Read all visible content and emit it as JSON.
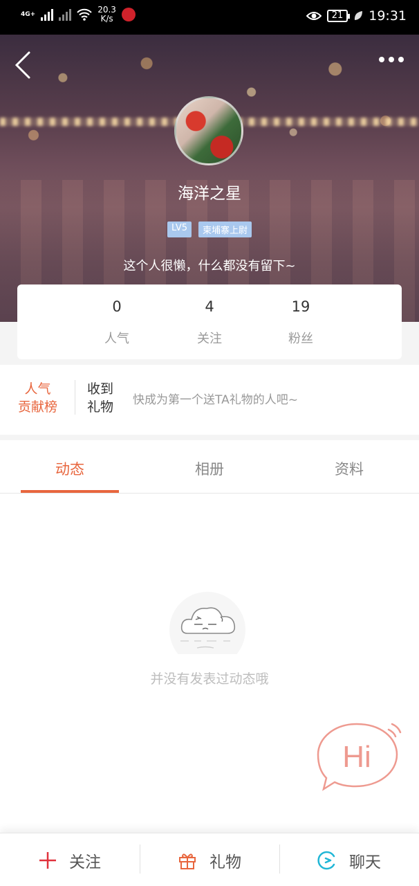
{
  "status_bar": {
    "network_type": "4G+",
    "speed_value": "20.3",
    "speed_unit": "K/s",
    "battery_level": "21",
    "time": "19:31",
    "icons": [
      "signal-icon",
      "wifi-icon",
      "weibo-icon",
      "eye-icon",
      "battery-icon",
      "leaf-icon"
    ]
  },
  "profile": {
    "nickname": "海洋之星",
    "level_badge": "LV5",
    "title_badge": "柬埔寨上尉",
    "bio": "这个人很懒，什么都没有留下~"
  },
  "stats": [
    {
      "value": "0",
      "label": "人气"
    },
    {
      "value": "4",
      "label": "关注"
    },
    {
      "value": "19",
      "label": "粉丝"
    }
  ],
  "gifts": {
    "rank_line1": "人气",
    "rank_line2": "贡献榜",
    "received_line1": "收到",
    "received_line2": "礼物",
    "prompt": "快成为第一个送TA礼物的人吧~"
  },
  "tabs": [
    {
      "label": "动态",
      "active": true
    },
    {
      "label": "相册",
      "active": false
    },
    {
      "label": "资料",
      "active": false
    }
  ],
  "empty_state": {
    "message": "并没有发表过动态哦"
  },
  "hi_button": {
    "label": "Hi"
  },
  "bottom_bar": {
    "follow": "关注",
    "gift": "礼物",
    "chat": "聊天"
  },
  "colors": {
    "accent": "#e8663e",
    "follow_icon": "#e0323c",
    "chat_icon": "#1fb6d6",
    "badge": "#a9c8ee",
    "hi": "#ee9a90"
  }
}
